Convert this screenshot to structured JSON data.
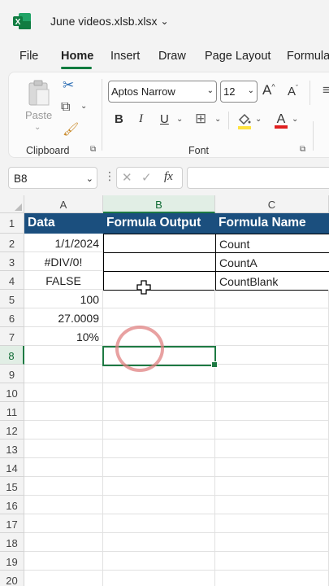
{
  "titlebar": {
    "filename": "June videos.xlsb.xlsx"
  },
  "tabs": [
    {
      "label": "File"
    },
    {
      "label": "Home"
    },
    {
      "label": "Insert"
    },
    {
      "label": "Draw"
    },
    {
      "label": "Page Layout"
    },
    {
      "label": "Formula"
    }
  ],
  "ribbon": {
    "paste_label": "Paste",
    "clipboard_label": "Clipboard",
    "font_label": "Font",
    "font_name": "Aptos Narrow",
    "font_size": "12",
    "bold": "B",
    "italic": "I",
    "underline": "U",
    "grow": "A",
    "shrink": "A"
  },
  "formula_bar": {
    "name_box": "B8",
    "fx": "fx",
    "value": ""
  },
  "grid": {
    "columns": [
      "A",
      "B",
      "C"
    ],
    "selected_column": "B",
    "rows": [
      "1",
      "2",
      "3",
      "4",
      "5",
      "6",
      "7",
      "8",
      "9",
      "10",
      "11",
      "12",
      "13",
      "14",
      "15",
      "16",
      "17",
      "18",
      "19",
      "20"
    ],
    "selected_row": "8",
    "headers": [
      "Data",
      "Formula Output",
      "Formula Name"
    ],
    "data_values": [
      "1/1/2024",
      "#DIV/0!",
      "FALSE",
      "100",
      "27.0009",
      "10%"
    ],
    "formula_names": [
      "Count",
      "CountA",
      "CountBlank"
    ]
  },
  "colors": {
    "accent": "#1e7a43",
    "header_fill": "#1b4f7e",
    "excel_green": "#107c41"
  }
}
